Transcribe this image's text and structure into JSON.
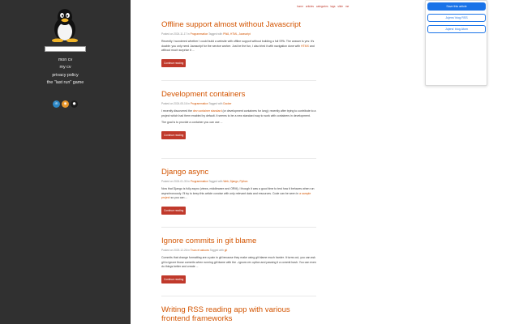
{
  "sidebar": {
    "search_placeholder": "",
    "links": [
      "mon cv",
      "my cv",
      "privacy policy",
      "the \"last run\" game"
    ],
    "social": [
      {
        "icon": "linkedin-icon",
        "glyph": "in"
      },
      {
        "icon": "rss-icon",
        "glyph": "◉"
      },
      {
        "icon": "github-icon",
        "glyph": "●"
      }
    ]
  },
  "top_nav": [
    "home",
    "articles",
    "categories",
    "tags",
    "slide",
    "me"
  ],
  "posts": [
    {
      "title": "Offline support almost without Javascript",
      "date": "Posted on 2024-11-17",
      "in_label": "in",
      "category": "Programmation",
      "tagged_label": "Tagged with",
      "tags": "PWA, HTML, Javascript",
      "excerpt_pre": "Recently I wondered whether I could build a website with offline support without building a full SPA. The answer is yes: it's doable: you only need Javascript for the service worker. Just be the fun, I also tried it with navigation done with",
      "excerpt_link": "HTMX",
      "excerpt_post": "and without much surprise it ...",
      "more": "",
      "button": "Continue reading"
    },
    {
      "title": "Development containers",
      "date": "Posted on 2024-05-16",
      "in_label": "in",
      "category": "Programmation",
      "tagged_label": "Tagged with",
      "tags": "Docker",
      "excerpt_pre": "I recently discovered the",
      "excerpt_link": "dev container standard",
      "excerpt_post": "(or development containers for long): recently after trying to contribute to a project which had them enabled by default. It seems to be a new standard way to work with containers in development.",
      "more": "The goal is to provide a container you can use ...",
      "button": "Continue reading"
    },
    {
      "title": "Django async",
      "date": "Posted on 2024-01-30",
      "in_label": "in",
      "category": "Programmation",
      "tagged_label": "Tagged with",
      "tags": "Web, Django, Python",
      "excerpt_pre": "Now that Django is fully async (views, middleware and ORM), I though it was a good time to test how it behaves when run asynchronously. I'll try to keep this article concise with only relevant data and resources. Code can be seen in",
      "excerpt_link": "a sample project",
      "excerpt_post": "so you can ...",
      "more": "",
      "button": "Continue reading"
    },
    {
      "title": "Ignore commits in git blame",
      "date": "Posted on 2023-12-26",
      "in_label": "in",
      "category": "Trucs et astuces",
      "tagged_label": "Tagged with",
      "tags": "git",
      "excerpt_pre": "Commits that change formatting are a pain in git because they make using git blame much harder. It turns out, you can ask git to ignore those commits when running git blame with the --ignore-rev option and passing it a commit hash. You can even do things better and create ...",
      "excerpt_link": "",
      "excerpt_post": "",
      "more": "",
      "button": "Continue reading"
    },
    {
      "title": "Writing RSS reading app with various frontend frameworks"
    }
  ],
  "popup": {
    "save_label": "Save this article",
    "rss_label": "Jujens' blog RSS",
    "atom_label": "Jujens' blog Atom"
  },
  "colors": {
    "sidebar_bg": "#303030",
    "accent": "#d35400",
    "button": "#c0392b",
    "popup_primary": "#1a73e8"
  }
}
